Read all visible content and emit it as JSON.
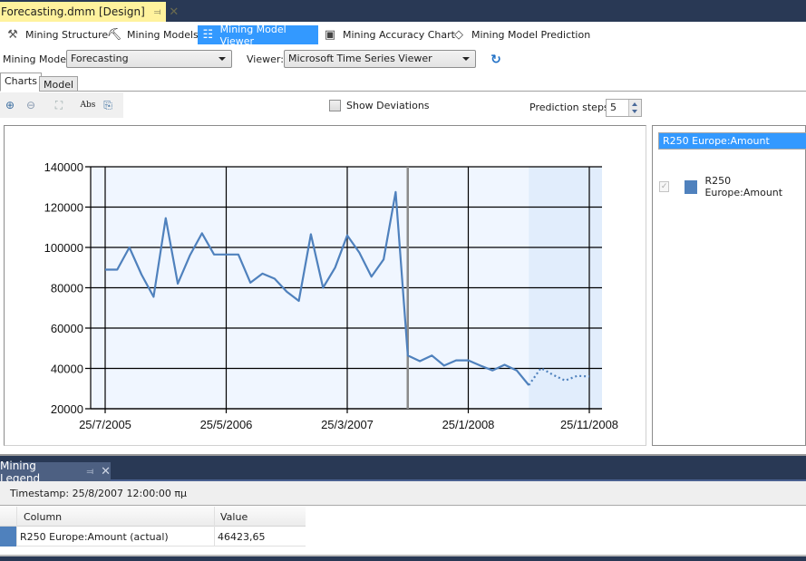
{
  "document_tab": {
    "title": "Forecasting.dmm [Design]",
    "pin_icon": "pin-icon",
    "close_icon": "close-icon"
  },
  "designer_tabs": [
    {
      "label": "Mining Structure",
      "icon": "mining-structure-icon",
      "active": false
    },
    {
      "label": "Mining Models",
      "icon": "pickaxe-icon",
      "active": false
    },
    {
      "label": "Mining Model Viewer",
      "icon": "model-viewer-icon",
      "active": true
    },
    {
      "label": "Mining Accuracy Chart",
      "icon": "accuracy-chart-icon",
      "active": false
    },
    {
      "label": "Mining Model Prediction",
      "icon": "diamond-icon",
      "active": false
    }
  ],
  "model_row": {
    "mining_model_label": "Mining Model:",
    "mining_model_value": "Forecasting",
    "viewer_label": "Viewer:",
    "viewer_value": "Microsoft Time Series Viewer",
    "refresh_icon": "refresh-icon"
  },
  "sub_tabs": [
    {
      "label": "Charts",
      "active": true
    },
    {
      "label": "Model",
      "active": false
    }
  ],
  "chart_toolbar": {
    "buttons": [
      "zoom-in-icon",
      "zoom-out-icon",
      "fit-icon",
      "abs-icon",
      "copy-icon"
    ],
    "abs_label": "Abs",
    "show_deviations_label": "Show Deviations",
    "show_deviations_checked": false,
    "prediction_steps_label": "Prediction steps",
    "prediction_steps_value": "5"
  },
  "series_panel": {
    "selected": "R250 Europe:Amount",
    "items": [
      {
        "label": "R250 Europe:Amount",
        "checked": true,
        "color": "#4f81bd"
      }
    ]
  },
  "chart_data": {
    "type": "line",
    "title": "",
    "xlabel": "",
    "ylabel": "",
    "ylim": [
      20000,
      140000
    ],
    "yticks": [
      "140000",
      "120000",
      "100000",
      "80000",
      "60000",
      "40000",
      "20000"
    ],
    "xtick_labels": [
      "25/7/2005",
      "25/5/2006",
      "25/3/2007",
      "25/1/2008",
      "25/11/2008"
    ],
    "x_start": "25/7/2005",
    "x_unit": "month",
    "grid": true,
    "series": [
      {
        "name": "R250 Europe:Amount",
        "color": "#4f81bd",
        "actual": [
          89000,
          89000,
          100000,
          86500,
          75500,
          114500,
          82000,
          96000,
          107000,
          96500,
          96500,
          96500,
          82500,
          87000,
          84500,
          78000,
          73500,
          106500,
          80000,
          90000,
          106000,
          97500,
          85500,
          94000,
          127500,
          46423.65,
          43600,
          46400,
          41400,
          44000,
          44000,
          41400,
          39000,
          41800,
          39000,
          31700
        ],
        "predicted": [
          31700,
          40200,
          36800,
          34000,
          36300,
          36000
        ]
      }
    ],
    "selected_timestamp_index": 25,
    "prediction_region_start_index": 35
  },
  "mining_legend": {
    "title": "Mining Legend",
    "timestamp": "Timestamp: 25/8/2007 12:00:00 πμ",
    "columns": [
      "Column",
      "Value"
    ],
    "rows": [
      {
        "column": "R250 Europe:Amount (actual)",
        "value": "46423,65",
        "color": "#4f81bd"
      }
    ]
  }
}
